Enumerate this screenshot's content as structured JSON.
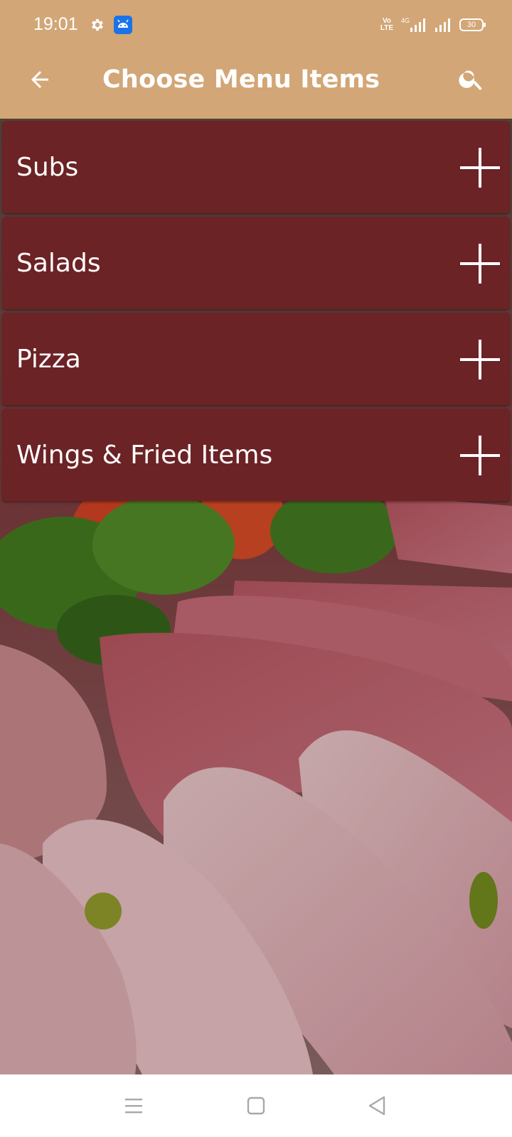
{
  "status_bar": {
    "time": "19:01",
    "network_badge_top": "Vo",
    "network_badge_bottom": "LTE",
    "network_type": "4G",
    "battery": "30",
    "icons": [
      "gear-icon",
      "android-app-icon",
      "volte-icon",
      "signal-icon",
      "signal-icon",
      "battery-icon"
    ]
  },
  "app_bar": {
    "title": "Choose Menu Items",
    "back_icon": "arrow-left-icon",
    "search_icon": "search-icon",
    "background_color": "#d2a676"
  },
  "menu": {
    "item_color": "#6c2326",
    "expand_icon": "plus-icon",
    "items": [
      {
        "label": "Subs"
      },
      {
        "label": "Salads"
      },
      {
        "label": "Pizza"
      },
      {
        "label": "Wings & Fried Items"
      }
    ]
  },
  "nav_bar": {
    "icons": [
      "menu-lines-icon",
      "home-square-icon",
      "back-triangle-icon"
    ]
  }
}
